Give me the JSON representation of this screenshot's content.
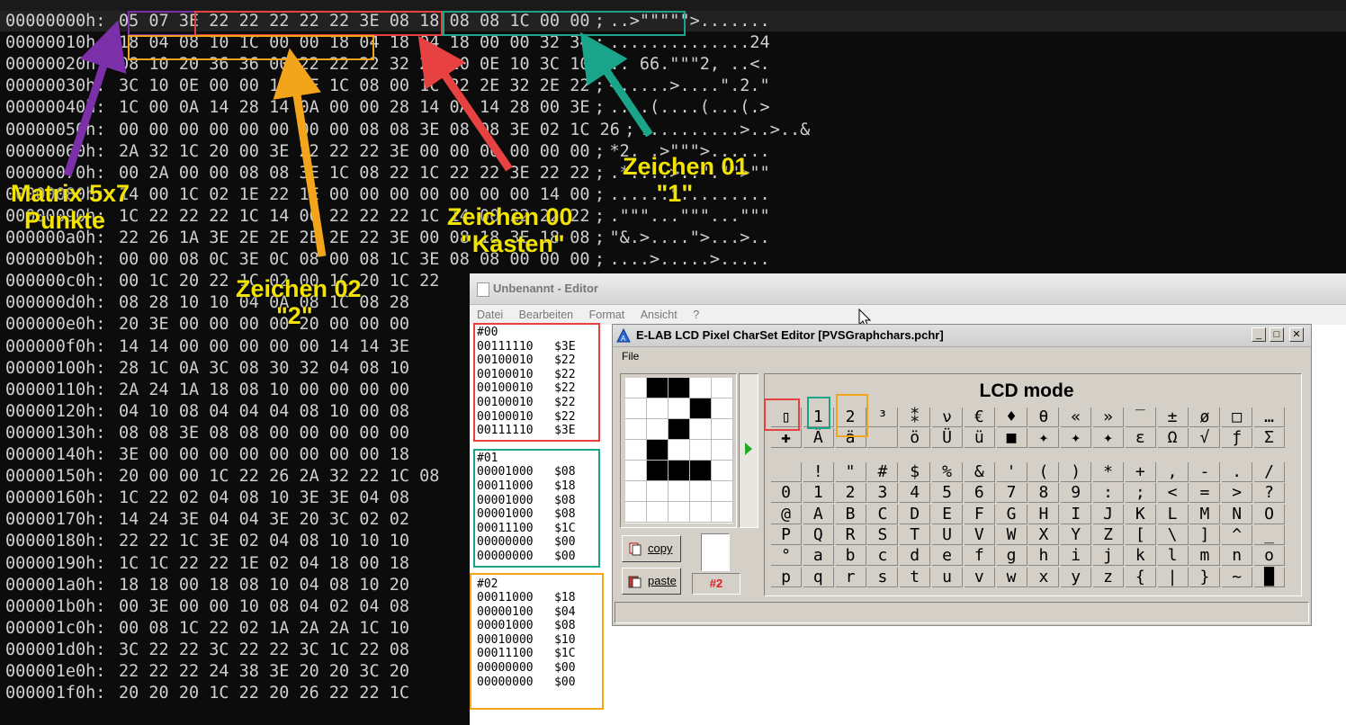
{
  "hex_editor": {
    "rows": [
      {
        "offset": "00000000h:",
        "bytes": "05 07 3E 22 22 22 22 22 3E 08 18 08 08 1C 00 00",
        "ascii": "..>\"\"\"\"\">......."
      },
      {
        "offset": "00000010h:",
        "bytes": "18 04 08 10 1C 00 00 18 04 18 04 18 00 00 32 34",
        "ascii": "..............24"
      },
      {
        "offset": "00000020h:",
        "bytes": "08 10 20 36 36 00 22 22 22 32 2C 20 0E 10 3C 10",
        "ascii": ".. 66.\"\"\"2, ..<."
      },
      {
        "offset": "00000030h:",
        "bytes": "3C 10 0E 00 00 1C 3E 1C 08 00 1C 22 2E 32 2E 22",
        "ascii": "<.....>....\".2.\""
      },
      {
        "offset": "00000040h:",
        "bytes": "1C 00 0A 14 28 14 0A 00 00 28 14 0A 14 28 00 3E",
        "ascii": "....(....(...(.>"
      },
      {
        "offset": "00000050h:",
        "bytes": "00 00 00 00 00 00 00 00 08 08 3E 08 08 3E 02 1C 26",
        "ascii": "..........>..>..&"
      },
      {
        "offset": "00000060h:",
        "bytes": "2A 32 1C 20 00 3E 22 22 22 3E 00 00 00 00 00 00",
        "ascii": "*2. .>\"\"\">......"
      },
      {
        "offset": "00000070h:",
        "bytes": "00 2A 00 00 08 08 3E 1C 08 22 1C 22 22 3E 22 22",
        "ascii": ".*....>..\".\"\">\"\""
      },
      {
        "offset": "00000080h:",
        "bytes": "14 00 1C 02 1E 22 1E 00 00 00 00 00 00 00 14 00",
        "ascii": "......\"........."
      },
      {
        "offset": "00000090h:",
        "bytes": "1C 22 22 22 1C 14 00 22 22 22 1C 14 00 22 22 22",
        "ascii": ".\"\"\"...\"\"\"...\"\"\""
      },
      {
        "offset": "000000a0h:",
        "bytes": "22 26 1A 3E 2E 2E 2E 2E 22 3E 00 08 18 3E 18 08",
        "ascii": "\"&.>....\">...>.."
      },
      {
        "offset": "000000b0h:",
        "bytes": "00 00 08 0C 3E 0C 08 00 08 1C 3E 08 08 00 00 00",
        "ascii": "....>.....>....."
      },
      {
        "offset": "000000c0h:",
        "bytes": "00 1C 20 22 1C 02 00 1C 20 1C 22",
        "ascii": ""
      },
      {
        "offset": "000000d0h:",
        "bytes": "08 28 10 10 04 0A 08 1C 08 28",
        "ascii": ""
      },
      {
        "offset": "000000e0h:",
        "bytes": "20 3E 00 00 00 00 20 00 00 00",
        "ascii": ""
      },
      {
        "offset": "000000f0h:",
        "bytes": "14 14 00 00 00 00 00 14 14 3E",
        "ascii": ""
      },
      {
        "offset": "00000100h:",
        "bytes": "28 1C 0A 3C 08 30 32 04 08 10",
        "ascii": ""
      },
      {
        "offset": "00000110h:",
        "bytes": "2A 24 1A 18 08 10 00 00 00 00",
        "ascii": ""
      },
      {
        "offset": "00000120h:",
        "bytes": "04 10 08 04 04 04 08 10 00 08",
        "ascii": ""
      },
      {
        "offset": "00000130h:",
        "bytes": "08 08 3E 08 08 00 00 00 00 00",
        "ascii": ""
      },
      {
        "offset": "00000140h:",
        "bytes": "3E 00 00 00 00 00 00 00 00 18",
        "ascii": ""
      },
      {
        "offset": "00000150h:",
        "bytes": "20 00 00 1C 22 26 2A 32 22 1C 08",
        "ascii": ""
      },
      {
        "offset": "00000160h:",
        "bytes": "1C 22 02 04 08 10 3E 3E 04 08",
        "ascii": ""
      },
      {
        "offset": "00000170h:",
        "bytes": "14 24 3E 04 04 3E 20 3C 02 02",
        "ascii": ""
      },
      {
        "offset": "00000180h:",
        "bytes": "22 22 1C 3E 02 04 08 10 10 10",
        "ascii": ""
      },
      {
        "offset": "00000190h:",
        "bytes": "1C 1C 22 22 1E 02 04 18 00 18",
        "ascii": ""
      },
      {
        "offset": "000001a0h:",
        "bytes": "18 18 00 18 08 10 04 08 10 20",
        "ascii": ""
      },
      {
        "offset": "000001b0h:",
        "bytes": "00 3E 00 00 10 08 04 02 04 08",
        "ascii": ""
      },
      {
        "offset": "000001c0h:",
        "bytes": "00 08 1C 22 02 1A 2A 2A 1C 10",
        "ascii": ""
      },
      {
        "offset": "000001d0h:",
        "bytes": "3C 22 22 3C 22 22 3C 1C 22 08",
        "ascii": ""
      },
      {
        "offset": "000001e0h:",
        "bytes": "22 22 22 24 38 3E 20 20 3C 20",
        "ascii": ""
      },
      {
        "offset": "000001f0h:",
        "bytes": "20 20 20 1C 22 20 26 22 22 1C",
        "ascii": ""
      }
    ],
    "separator": ";"
  },
  "annotations": {
    "matrix": "Matrix 5x7\n  Punkte",
    "zeichen02": "Zeichen 02\n      \"2\"",
    "zeichen00": "Zeichen 00\n  \"Kasten\"",
    "zeichen01": "Zeichen 01\n     \"1\"",
    "colors": {
      "purple": "#7b2fa8",
      "red": "#e84141",
      "teal": "#1aa58a",
      "orange": "#f2a51a",
      "yellow": "#f2e400"
    }
  },
  "notepad": {
    "title": "Unbenannt - Editor",
    "menu": [
      "Datei",
      "Bearbeiten",
      "Format",
      "Ansicht",
      "?"
    ],
    "blocks": [
      {
        "header": "#00",
        "lines": [
          "00111110   $3E",
          "00100010   $22",
          "00100010   $22",
          "00100010   $22",
          "00100010   $22",
          "00100010   $22",
          "00111110   $3E"
        ]
      },
      {
        "header": "#01",
        "lines": [
          "00001000   $08",
          "00011000   $18",
          "00001000   $08",
          "00001000   $08",
          "00011100   $1C",
          "00000000   $00",
          "00000000   $00"
        ]
      },
      {
        "header": "#02",
        "lines": [
          "00011000   $18",
          "00000100   $04",
          "00001000   $08",
          "00010000   $10",
          "00011100   $1C",
          "00000000   $00",
          "00000000   $00"
        ]
      }
    ]
  },
  "elab": {
    "title": "E-LAB LCD Pixel CharSet Editor [PVSGraphchars.pchr]",
    "menu": "File",
    "lcd_mode": "LCD mode",
    "copy_label": "copy",
    "paste_label": "paste",
    "char_number": "#2",
    "win_btns": [
      "_",
      "□",
      "✕"
    ],
    "pixels": [
      [
        0,
        1,
        1,
        0,
        0
      ],
      [
        0,
        0,
        0,
        1,
        0
      ],
      [
        0,
        0,
        1,
        0,
        0
      ],
      [
        0,
        1,
        0,
        0,
        0
      ],
      [
        0,
        1,
        1,
        1,
        0
      ],
      [
        0,
        0,
        0,
        0,
        0
      ],
      [
        0,
        0,
        0,
        0,
        0
      ]
    ],
    "custom_row1": [
      "▯",
      "1",
      "2",
      "³",
      "⁑",
      "ν",
      "€",
      "♦",
      "θ",
      "«",
      "»",
      "‾",
      "±",
      "ø",
      "□",
      "…"
    ],
    "custom_row2": [
      "✚",
      "Ä",
      "ä",
      "",
      "ö",
      "Ü",
      "ü",
      "■",
      "✦",
      "✦",
      "✦",
      "ε",
      "Ω",
      "√",
      "ƒ",
      "Σ"
    ],
    "ascii_rows": [
      [
        "",
        "!",
        "\"",
        "#",
        "$",
        "%",
        "&",
        "'",
        "(",
        ")",
        "*",
        "+",
        ",",
        "-",
        ".",
        "/"
      ],
      [
        "0",
        "1",
        "2",
        "3",
        "4",
        "5",
        "6",
        "7",
        "8",
        "9",
        ":",
        ";",
        "<",
        "=",
        ">",
        "?"
      ],
      [
        "@",
        "A",
        "B",
        "C",
        "D",
        "E",
        "F",
        "G",
        "H",
        "I",
        "J",
        "K",
        "L",
        "M",
        "N",
        "O"
      ],
      [
        "P",
        "Q",
        "R",
        "S",
        "T",
        "U",
        "V",
        "W",
        "X",
        "Y",
        "Z",
        "[",
        "\\",
        "]",
        "^",
        "_"
      ],
      [
        "°",
        "a",
        "b",
        "c",
        "d",
        "e",
        "f",
        "g",
        "h",
        "i",
        "j",
        "k",
        "l",
        "m",
        "n",
        "o"
      ],
      [
        "p",
        "q",
        "r",
        "s",
        "t",
        "u",
        "v",
        "w",
        "x",
        "y",
        "z",
        "{",
        "|",
        "}",
        "~",
        "█"
      ]
    ]
  }
}
